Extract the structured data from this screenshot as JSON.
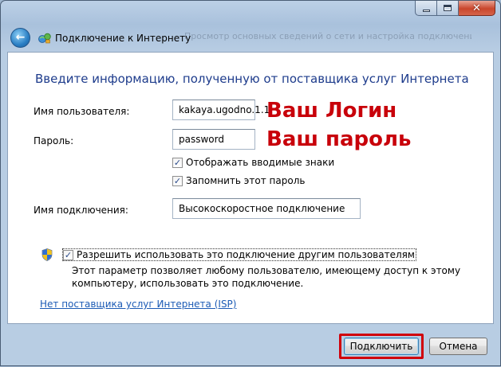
{
  "window": {
    "nav_title": "Подключение к Интернету",
    "background_text": "Просмотр основных сведений о сети и настройка подключений"
  },
  "heading": "Введите информацию, полученную от поставщика услуг Интернета",
  "form": {
    "username_label": "Имя пользователя:",
    "username_value": "kakaya.ugodno.1.1",
    "password_label": "Пароль:",
    "password_value": "password",
    "show_chars_label": "Отображать вводимые знаки",
    "show_chars_checked": true,
    "remember_label": "Запомнить этот пароль",
    "remember_checked": true,
    "connection_name_label": "Имя подключения:",
    "connection_name_value": "Высокоскоростное подключение"
  },
  "annotations": {
    "login": "Ваш Логин",
    "password": "Ваш пароль"
  },
  "allow_others": {
    "label": "Разрешить использовать это подключение другим пользователям",
    "checked": true,
    "description": "Этот параметр позволяет любому пользователю, имеющему доступ к этому компьютеру, использовать это подключение."
  },
  "isp_link": "Нет поставщика услуг Интернета (ISP)",
  "buttons": {
    "connect": "Подключить",
    "cancel": "Отмена"
  },
  "colors": {
    "heading": "#1e3c8c",
    "annotation": "#c8000a",
    "link": "#1c5bb5"
  },
  "icons": {
    "back": "back-arrow-icon",
    "network": "network-icon",
    "uac_shield": "uac-shield-icon"
  }
}
